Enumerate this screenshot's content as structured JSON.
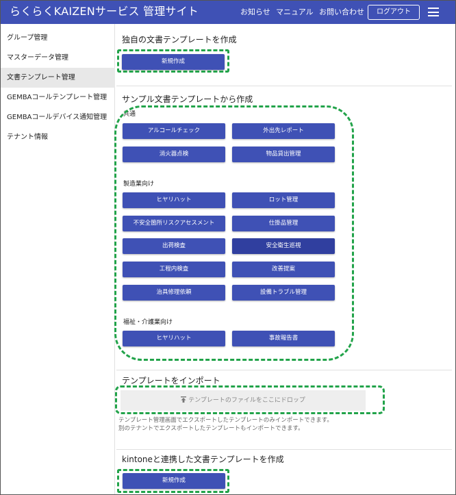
{
  "header": {
    "title": "らくらくKAIZENサービス 管理サイト",
    "nav": [
      "お知らせ",
      "マニュアル",
      "お問い合わせ"
    ],
    "logout_label": "ログアウト",
    "bg_color": "#3f51b5"
  },
  "sidebar": {
    "items": [
      {
        "label": "グループ管理"
      },
      {
        "label": "マスターデータ管理"
      },
      {
        "label": "文書テンプレート管理",
        "active": true
      },
      {
        "label": "GEMBAコールテンプレート管理"
      },
      {
        "label": "GEMBAコールデバイス通知管理"
      },
      {
        "label": "テナント情報"
      }
    ]
  },
  "custom_template": {
    "title": "独自の文書テンプレートを作成",
    "new_button": "新規作成"
  },
  "sample_templates": {
    "title": "サンプル文書テンプレートから作成",
    "groups": [
      {
        "label": "共通",
        "buttons": [
          "アルコールチェック",
          "外出先レポート",
          "消火器点検",
          "物品貸出管理"
        ]
      },
      {
        "label": "製造業向け",
        "buttons": [
          "ヒヤリハット",
          "ロット管理",
          "不安全箇所リスクアセスメント",
          "仕掛品管理",
          "出荷検査",
          "安全衛生巡視",
          "工程内検査",
          "改善提案",
          "治具修理依頼",
          "設備トラブル管理"
        ]
      },
      {
        "label": "福祉・介護業向け",
        "buttons": [
          "ヒヤリハット",
          "事故報告書"
        ]
      }
    ]
  },
  "import": {
    "title": "テンプレートをインポート",
    "dropzone_label": "テンプレートのファイルをここにドロップ",
    "help_lines": [
      "テンプレート管理画面でエクスポートしたテンプレートのみインポートできます。",
      "別のテナントでエクスポートしたテンプレートもインポートできます。"
    ]
  },
  "kintone": {
    "title": "kintoneと連携した文書テンプレートを作成",
    "new_button": "新規作成"
  },
  "colors": {
    "primary": "#3f51b5",
    "primary_dark": "#303f9f",
    "highlight": "#22a34a"
  }
}
